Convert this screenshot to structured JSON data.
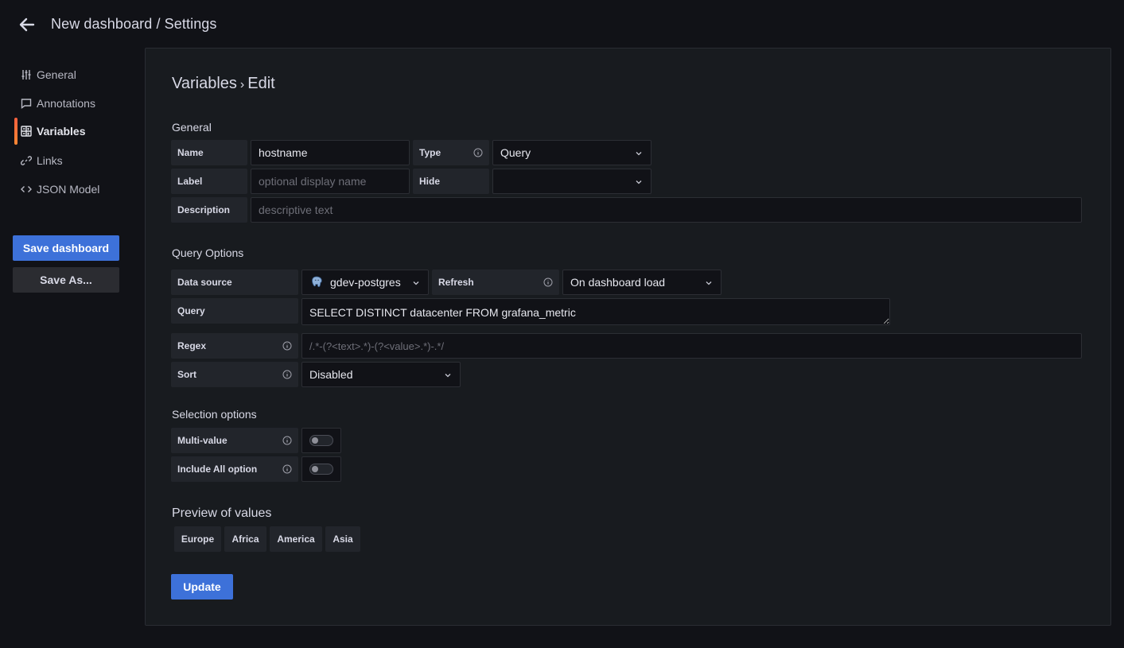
{
  "header": {
    "title": "New dashboard / Settings",
    "back_icon": "arrow-left-icon"
  },
  "sidebar": {
    "items": [
      {
        "label": "General",
        "icon": "sliders-icon"
      },
      {
        "label": "Annotations",
        "icon": "comment-icon"
      },
      {
        "label": "Variables",
        "icon": "calculator-icon",
        "active": true
      },
      {
        "label": "Links",
        "icon": "link-icon"
      },
      {
        "label": "JSON Model",
        "icon": "code-icon"
      }
    ],
    "save_label": "Save dashboard",
    "save_as_label": "Save As..."
  },
  "main": {
    "crumb_root": "Variables",
    "crumb_sep": "›",
    "crumb_leaf": "Edit",
    "general": {
      "title": "General",
      "name_label": "Name",
      "name_value": "hostname",
      "type_label": "Type",
      "type_value": "Query",
      "label_label": "Label",
      "label_placeholder": "optional display name",
      "hide_label": "Hide",
      "hide_value": "",
      "description_label": "Description",
      "description_placeholder": "descriptive text"
    },
    "query_options": {
      "title": "Query Options",
      "datasource_label": "Data source",
      "datasource_value": "gdev-postgres",
      "refresh_label": "Refresh",
      "refresh_value": "On dashboard load",
      "query_label": "Query",
      "query_value": "SELECT DISTINCT datacenter FROM grafana_metric",
      "regex_label": "Regex",
      "regex_placeholder": "/.*-(?<text>.*)-(?<value>.*)-.*/",
      "sort_label": "Sort",
      "sort_value": "Disabled"
    },
    "selection": {
      "title": "Selection options",
      "multi_label": "Multi-value",
      "include_all_label": "Include All option"
    },
    "preview": {
      "title": "Preview of values",
      "values": [
        "Europe",
        "Africa",
        "America",
        "Asia"
      ]
    },
    "update_label": "Update"
  },
  "colors": {
    "background": "#111217",
    "panel": "#181b1f",
    "primary": "#3d71d9",
    "active_accent": "#f55f3e"
  }
}
